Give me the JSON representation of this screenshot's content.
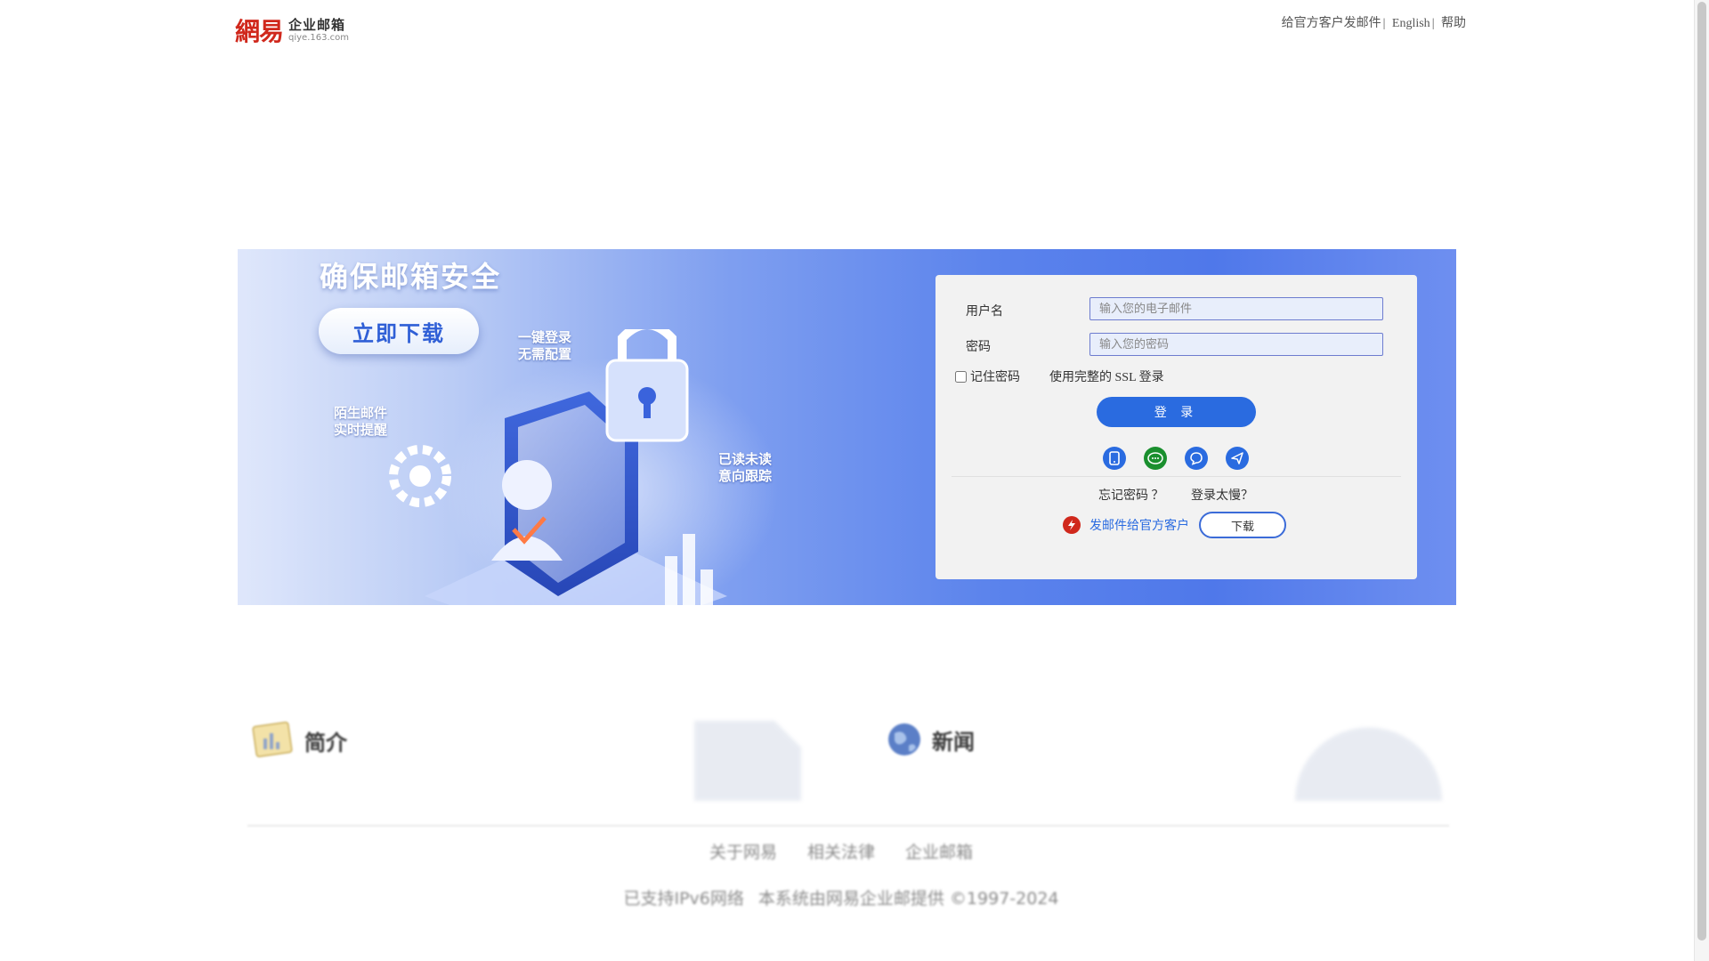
{
  "header": {
    "logo_mark": "網易",
    "logo_cn": "企业邮箱",
    "logo_en": "qiye.163.com",
    "links": [
      {
        "label": "给官方客户发邮件"
      },
      {
        "label": "English"
      },
      {
        "label": "帮助"
      }
    ]
  },
  "banner": {
    "title": "确保邮箱安全",
    "button": "立即下载",
    "notes": [
      {
        "l1": "一键登录",
        "l2": "无需配置"
      },
      {
        "l1": "陌生邮件",
        "l2": "实时提醒"
      },
      {
        "l1": "已读未读",
        "l2": "意向跟踪"
      }
    ]
  },
  "login": {
    "username_label": "用户名",
    "username_placeholder": "输入您的电子邮件",
    "password_label": "密码",
    "password_placeholder": "输入您的密码",
    "remember_label": "记住密码",
    "ssl_label": "使用完整的 SSL 登录",
    "submit": "登 录",
    "forgot": "忘记密码 ？",
    "slow": "登录太慢？",
    "official_link": "发邮件给官方客户",
    "download": "下载"
  },
  "sections": {
    "intro": "简介",
    "news": "新闻"
  },
  "footer": {
    "links": [
      "关于网易",
      "相关法律",
      "企业邮箱"
    ],
    "ipv6": "已支持IPv6网络",
    "copyright": "本系统由网易企业邮提供 ©1997-2024"
  },
  "colors": {
    "accent": "#2a6be0",
    "brand_red": "#d0281c"
  }
}
